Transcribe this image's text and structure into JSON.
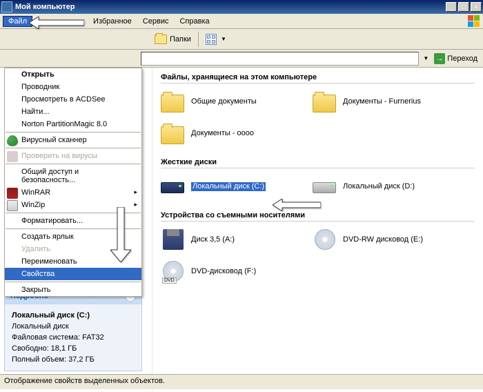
{
  "title": "Мой компьютер",
  "menubar": [
    "Файл",
    "Избранное",
    "Сервис",
    "Справка"
  ],
  "toolbar": {
    "folders": "Папки"
  },
  "addrbar": {
    "go": "Переход"
  },
  "file_menu": {
    "open": "Открыть",
    "explorer": "Проводник",
    "acdsee": "Просмотреть в ACDSee",
    "find": "Найти...",
    "norton": "Norton PartitionMagic 8.0",
    "virus_scanner": "Вирусный сканнер",
    "check_viruses": "Проверить на вирусы",
    "share_security": "Общий доступ и безопасность...",
    "winrar": "WinRAR",
    "winzip": "WinZip",
    "format": "Форматировать...",
    "create_shortcut": "Создать ярлык",
    "delete": "Удалить",
    "rename": "Переименовать",
    "properties": "Свойства",
    "close": "Закрыть"
  },
  "details": {
    "header": "Подробно",
    "name": "Локальный диск (C:)",
    "type": "Локальный диск",
    "fs_label": "Файловая система: FAT32",
    "free": "Свободно: 18,1 ГБ",
    "total": "Полный объем: 37,2 ГБ"
  },
  "sections": {
    "files": "Файлы, хранящиеся на этом компьютере",
    "hdd": "Жесткие диски",
    "removable": "Устройства со съемными носителями"
  },
  "folders": {
    "shared": "Общие документы",
    "user": "Документы - Furnerius",
    "oooo": "Документы - oooo"
  },
  "drives": {
    "c": "Локальный диск (C:)",
    "d": "Локальный диск (D:)",
    "a": "Диск 3,5 (A:)",
    "e": "DVD-RW дисковод (E:)",
    "f": "DVD-дисковод (F:)"
  },
  "statusbar": "Отображение свойств выделенных объектов."
}
